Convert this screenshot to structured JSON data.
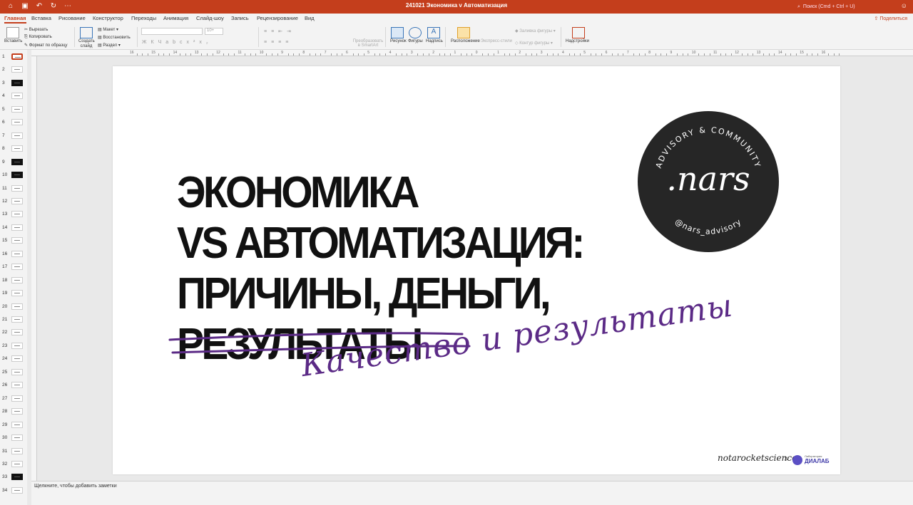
{
  "titlebar": {
    "title": "241021 Экономика v Автоматизация",
    "search_placeholder": "Поиск (Cmd + Ctrl + U)",
    "icons": [
      "home-icon",
      "save-icon",
      "undo-icon",
      "redo-icon",
      "more-icon"
    ]
  },
  "menu": {
    "tabs": [
      "Главная",
      "Вставка",
      "Рисование",
      "Конструктор",
      "Переходы",
      "Анимация",
      "Слайд-шоу",
      "Запись",
      "Рецензирование",
      "Вид"
    ],
    "active_tab": "Главная",
    "share_label": "Поделиться"
  },
  "ribbon": {
    "paste": "Вставить",
    "cut": "Вырезать",
    "copy": "Копировать",
    "format_painter": "Формат по образцу",
    "new_slide": "Создать слайд",
    "layout": "Макет",
    "reset": "Восстановить",
    "section": "Раздел",
    "font_size": "10+",
    "convert_smartart": "Преобразовать в SmartArt",
    "picture": "Рисунок",
    "shapes": "Фигуры",
    "textbox": "Надпись",
    "arrange": "Расположение",
    "quick_styles": "Экспресс-стили",
    "shape_fill": "Заливка фигуры",
    "shape_outline": "Контур фигуры",
    "addins": "Надстройки"
  },
  "ruler": {
    "labels": [
      "16",
      "15",
      "14",
      "13",
      "12",
      "11",
      "10",
      "9",
      "8",
      "7",
      "6",
      "5",
      "4",
      "3",
      "2",
      "1",
      "0",
      "1",
      "2",
      "3",
      "4",
      "5",
      "6",
      "7",
      "8",
      "9",
      "10",
      "11",
      "12",
      "13",
      "14",
      "15",
      "16"
    ]
  },
  "thumbnails": {
    "numbers": [
      "1",
      "2",
      "3",
      "4",
      "5",
      "6",
      "7",
      "8",
      "9",
      "10",
      "11",
      "12",
      "13",
      "14",
      "15",
      "16",
      "17",
      "18",
      "19",
      "20",
      "21",
      "22",
      "23",
      "24",
      "25",
      "26",
      "27",
      "28",
      "29",
      "30",
      "31",
      "32",
      "33",
      "34"
    ],
    "dark": [
      "3",
      "9",
      "10",
      "33"
    ],
    "selected": "1"
  },
  "slide": {
    "title_lines": [
      "ЭКОНОМИКА",
      "VS АВТОМАТИЗАЦИЯ:",
      "ПРИЧИНЫ, ДЕНЬГИ,",
      "РЕЗУЛЬТАТЫ"
    ],
    "struck_word": "РЕЗУЛЬТАТЫ",
    "handwritten": "Качество и результаты",
    "badge_top_text": "ADVISORY & COMMUNITY",
    "badge_logo": ".nars",
    "badge_bottom_text": "@nars_advisory",
    "footer_brand": "notarocketscience",
    "footer_x": "x",
    "footer_lab_small": "Лаборатория",
    "footer_lab_name": "ДИАЛАБ",
    "accent_color": "#5b2a86"
  },
  "notes": {
    "placeholder": "Щелкните, чтобы добавить заметки"
  },
  "colors": {
    "titlebar": "#c43e1c",
    "accent": "#c43e1c"
  }
}
